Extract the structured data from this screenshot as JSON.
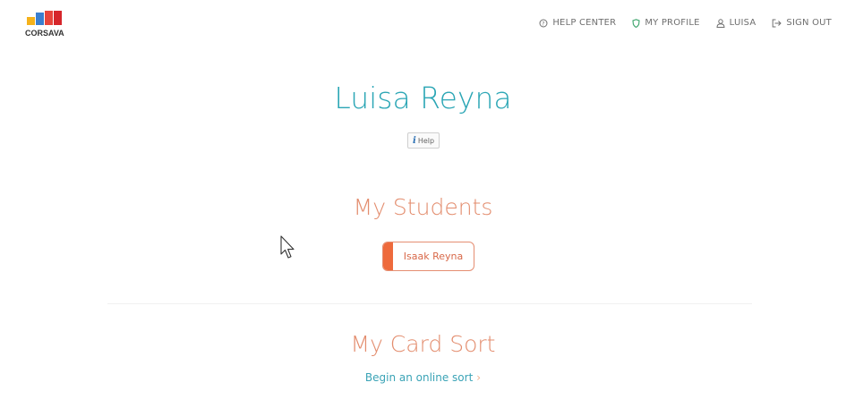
{
  "header": {
    "logo_text": "CORSAVA",
    "nav": {
      "help_center": "HELP CENTER",
      "my_profile": "MY PROFILE",
      "user": "LUISA",
      "sign_out": "SIGN OUT"
    }
  },
  "main": {
    "user_name": "Luisa Reyna",
    "help_label": "Help",
    "students_title": "My Students",
    "students": [
      "Isaak Reyna"
    ],
    "card_sort_title": "My Card Sort",
    "card_sort_link": "Begin an online sort"
  },
  "colors": {
    "name": "#2ba6b5",
    "section_title": "#e38d6e",
    "student_accent": "#ee6a3c",
    "link": "#3aa3b6",
    "logo": [
      "#f5b21b",
      "#3a7fd0",
      "#e8453c",
      "#d6262b"
    ]
  }
}
